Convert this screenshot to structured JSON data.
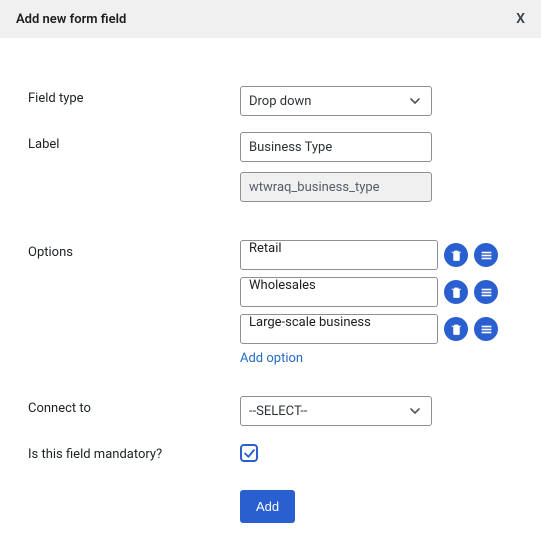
{
  "header": {
    "title": "Add new form field",
    "close": "X"
  },
  "fields": {
    "field_type": {
      "label": "Field type",
      "value": "Drop down"
    },
    "label": {
      "label": "Label",
      "value": "Business Type",
      "slug": "wtwraq_business_type"
    },
    "options": {
      "label": "Options",
      "items": [
        "Retail",
        "Wholesales",
        "Large-scale business"
      ],
      "add_link": "Add option"
    },
    "connect_to": {
      "label": "Connect to",
      "value": "--SELECT--"
    },
    "mandatory": {
      "label": "Is this field mandatory?",
      "checked": true
    }
  },
  "buttons": {
    "submit": "Add"
  }
}
